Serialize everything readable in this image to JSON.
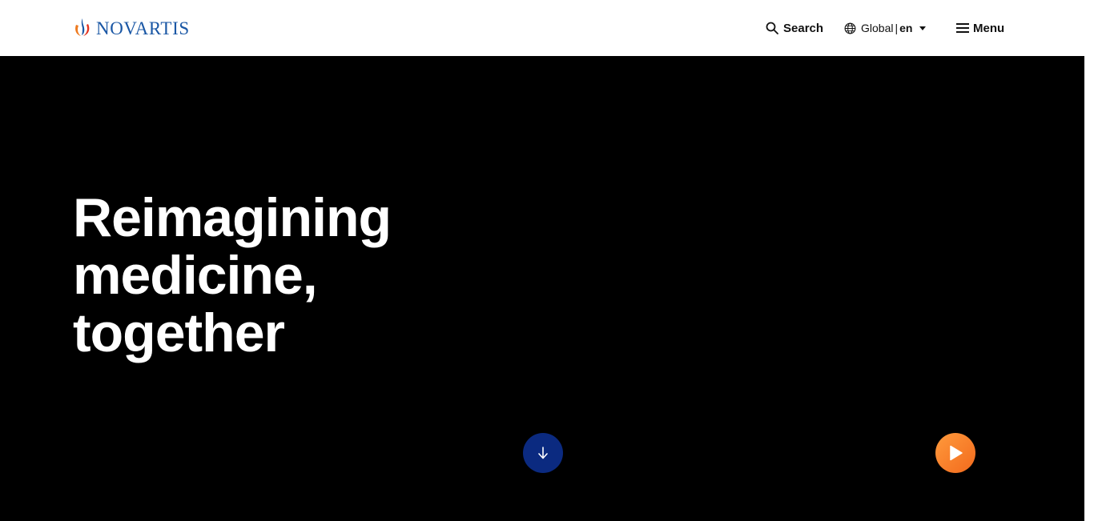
{
  "brand": {
    "name": "NOVARTIS",
    "logo_icon": "novartis-flame-icon",
    "colors": {
      "text_blue": "#1a57a5",
      "flame_orange": "#ee7a1f",
      "flame_red": "#e5331f"
    }
  },
  "header": {
    "search": {
      "label": "Search",
      "icon": "search-icon"
    },
    "language": {
      "region": "Global",
      "separator": "|",
      "code": "en",
      "icon": "globe-icon",
      "caret_icon": "caret-down-icon"
    },
    "menu": {
      "label": "Menu",
      "icon": "hamburger-icon"
    }
  },
  "hero": {
    "headline_lines": [
      "Reimagining",
      "medicine,",
      "together"
    ],
    "background": "#000000",
    "scroll_button": {
      "icon": "arrow-down-icon",
      "color": "#0b2a80"
    },
    "play_button": {
      "icon": "play-icon",
      "colors": [
        "#ff9a3c",
        "#f26a1d"
      ]
    }
  }
}
